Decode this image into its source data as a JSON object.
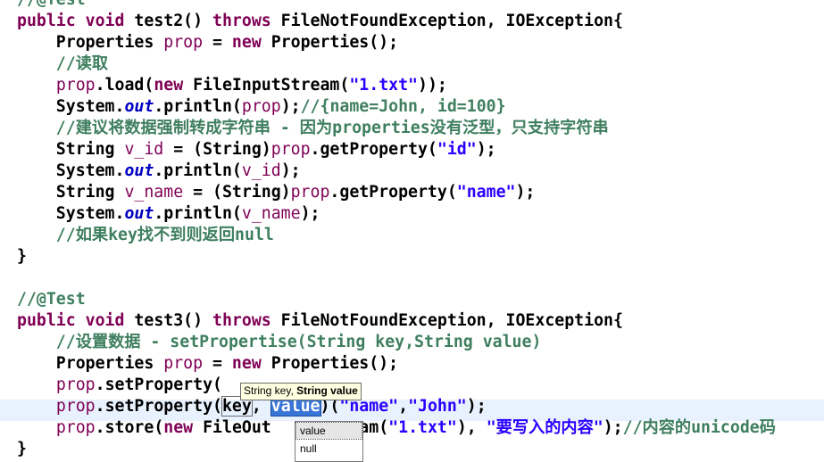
{
  "editor": {
    "lines": [
      {
        "parts": [
          {
            "t": "//@Test",
            "c": "cm"
          }
        ]
      },
      {
        "parts": [
          {
            "t": "public",
            "c": "kw"
          },
          {
            "t": " "
          },
          {
            "t": "void",
            "c": "kw"
          },
          {
            "t": " test2() "
          },
          {
            "t": "throws",
            "c": "kw"
          },
          {
            "t": " FileNotFoundException, IOException{"
          }
        ]
      },
      {
        "parts": [
          {
            "t": "    Properties "
          },
          {
            "t": "prop",
            "c": "var"
          },
          {
            "t": " = "
          },
          {
            "t": "new",
            "c": "kw"
          },
          {
            "t": " Properties();"
          }
        ]
      },
      {
        "parts": [
          {
            "t": "    //读取",
            "c": "cm"
          }
        ]
      },
      {
        "parts": [
          {
            "t": "    "
          },
          {
            "t": "prop",
            "c": "var"
          },
          {
            "t": ".load("
          },
          {
            "t": "new",
            "c": "kw"
          },
          {
            "t": " FileInputStream("
          },
          {
            "t": "\"1.txt\"",
            "c": "str"
          },
          {
            "t": "));"
          }
        ]
      },
      {
        "parts": [
          {
            "t": "    System."
          },
          {
            "t": "out",
            "c": "fld"
          },
          {
            "t": ".println("
          },
          {
            "t": "prop",
            "c": "var"
          },
          {
            "t": ");"
          },
          {
            "t": "//{name=John, id=100}",
            "c": "cm"
          }
        ]
      },
      {
        "parts": [
          {
            "t": "    //建议将数据强制转成字符串 - 因为properties没有泛型，只支持字符串",
            "c": "cm"
          }
        ]
      },
      {
        "parts": [
          {
            "t": "    String "
          },
          {
            "t": "v_id",
            "c": "var"
          },
          {
            "t": " = (String)"
          },
          {
            "t": "prop",
            "c": "var"
          },
          {
            "t": ".getProperty("
          },
          {
            "t": "\"id\"",
            "c": "str"
          },
          {
            "t": ");"
          }
        ]
      },
      {
        "parts": [
          {
            "t": "    System."
          },
          {
            "t": "out",
            "c": "fld"
          },
          {
            "t": ".println("
          },
          {
            "t": "v_id",
            "c": "var"
          },
          {
            "t": ");"
          }
        ]
      },
      {
        "parts": [
          {
            "t": "    String "
          },
          {
            "t": "v_name",
            "c": "var"
          },
          {
            "t": " = (String)"
          },
          {
            "t": "prop",
            "c": "var"
          },
          {
            "t": ".getProperty("
          },
          {
            "t": "\"name\"",
            "c": "str"
          },
          {
            "t": ");"
          }
        ]
      },
      {
        "parts": [
          {
            "t": "    System."
          },
          {
            "t": "out",
            "c": "fld"
          },
          {
            "t": ".println("
          },
          {
            "t": "v_name",
            "c": "var"
          },
          {
            "t": ");"
          }
        ]
      },
      {
        "parts": [
          {
            "t": "    //如果key找不到则返回null",
            "c": "cm"
          }
        ]
      },
      {
        "parts": [
          {
            "t": "}"
          }
        ]
      },
      {
        "parts": [
          {
            "t": ""
          }
        ]
      },
      {
        "parts": [
          {
            "t": "//@Test",
            "c": "cm"
          }
        ]
      },
      {
        "parts": [
          {
            "t": "public",
            "c": "kw"
          },
          {
            "t": " "
          },
          {
            "t": "void",
            "c": "kw"
          },
          {
            "t": " test3() "
          },
          {
            "t": "throws",
            "c": "kw"
          },
          {
            "t": " FileNotFoundException, IOException{"
          }
        ]
      },
      {
        "parts": [
          {
            "t": "    //设置数据 - setPropertise(String key,String value)",
            "c": "cm"
          }
        ]
      },
      {
        "parts": [
          {
            "t": "    Properties "
          },
          {
            "t": "prop",
            "c": "var"
          },
          {
            "t": " = "
          },
          {
            "t": "new",
            "c": "kw"
          },
          {
            "t": " Properties();"
          }
        ]
      },
      {
        "parts": [
          {
            "t": "    "
          },
          {
            "t": "prop",
            "c": "var"
          },
          {
            "t": ".setProperty("
          }
        ]
      },
      {
        "parts": [
          {
            "t": "    "
          },
          {
            "t": "prop",
            "c": "var"
          },
          {
            "t": ".setProperty("
          },
          {
            "t": "key",
            "c": "kbox"
          },
          {
            "t": ", "
          },
          {
            "t": "value",
            "c": "sel"
          },
          {
            "t": ")("
          },
          {
            "t": "\"name\"",
            "c": "str"
          },
          {
            "t": ","
          },
          {
            "t": "\"John\"",
            "c": "str"
          },
          {
            "t": ");"
          }
        ]
      },
      {
        "parts": [
          {
            "t": "    "
          },
          {
            "t": "prop",
            "c": "var"
          },
          {
            "t": ".store("
          },
          {
            "t": "new",
            "c": "kw"
          },
          {
            "t": " FileOut"
          },
          {
            "t": "        "
          },
          {
            "t": "eam("
          },
          {
            "t": "\"1.txt\"",
            "c": "str"
          },
          {
            "t": "), "
          },
          {
            "t": "\"要写入的内容\"",
            "c": "str"
          },
          {
            "t": ");"
          },
          {
            "t": "//内容的unicode码",
            "c": "cm"
          }
        ]
      },
      {
        "parts": [
          {
            "t": "}"
          }
        ]
      }
    ]
  },
  "tooltip": {
    "param1": "String key,",
    "param2": "String value"
  },
  "completion": {
    "items": [
      "value",
      "null"
    ]
  }
}
